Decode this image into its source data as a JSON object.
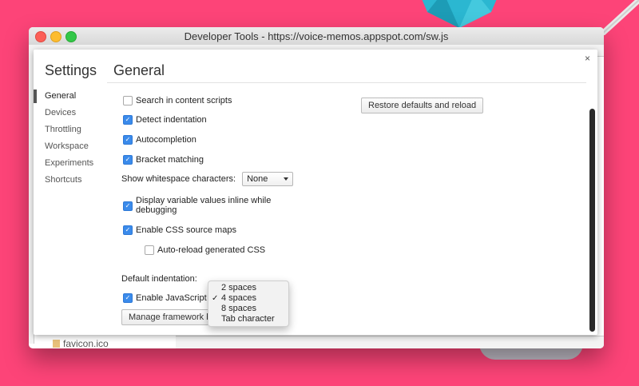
{
  "window": {
    "title": "Developer Tools - https://voice-memos.appspot.com/sw.js"
  },
  "background": {
    "file_name": "favicon.ico"
  },
  "settings": {
    "panel_title": "Settings",
    "close_glyph": "×",
    "section_title": "General",
    "nav": [
      {
        "label": "General",
        "active": true
      },
      {
        "label": "Devices",
        "active": false
      },
      {
        "label": "Throttling",
        "active": false
      },
      {
        "label": "Workspace",
        "active": false
      },
      {
        "label": "Experiments",
        "active": false
      },
      {
        "label": "Shortcuts",
        "active": false
      }
    ],
    "options": {
      "search_content_scripts": {
        "label": "Search in content scripts",
        "checked": false
      },
      "detect_indentation": {
        "label": "Detect indentation",
        "checked": true
      },
      "autocompletion": {
        "label": "Autocompletion",
        "checked": true
      },
      "bracket_matching": {
        "label": "Bracket matching",
        "checked": true
      },
      "display_inline": {
        "label": "Display variable values inline while debugging",
        "checked": true
      },
      "css_source_maps": {
        "label": "Enable CSS source maps",
        "checked": true
      },
      "auto_reload_css": {
        "label": "Auto-reload generated CSS",
        "checked": false
      },
      "enable_js": {
        "label": "Enable JavaScript",
        "checked": true
      }
    },
    "whitespace": {
      "label": "Show whitespace characters:",
      "value": "None"
    },
    "indentation": {
      "label": "Default indentation:",
      "options": [
        "2 spaces",
        "4 spaces",
        "8 spaces",
        "Tab character"
      ],
      "selected": "4 spaces"
    },
    "buttons": {
      "restore": "Restore defaults and reload",
      "blackboxing": "Manage framework blackboxing..."
    }
  },
  "colors": {
    "background": "#fd4478",
    "checkbox_on": "#3b8beb"
  }
}
